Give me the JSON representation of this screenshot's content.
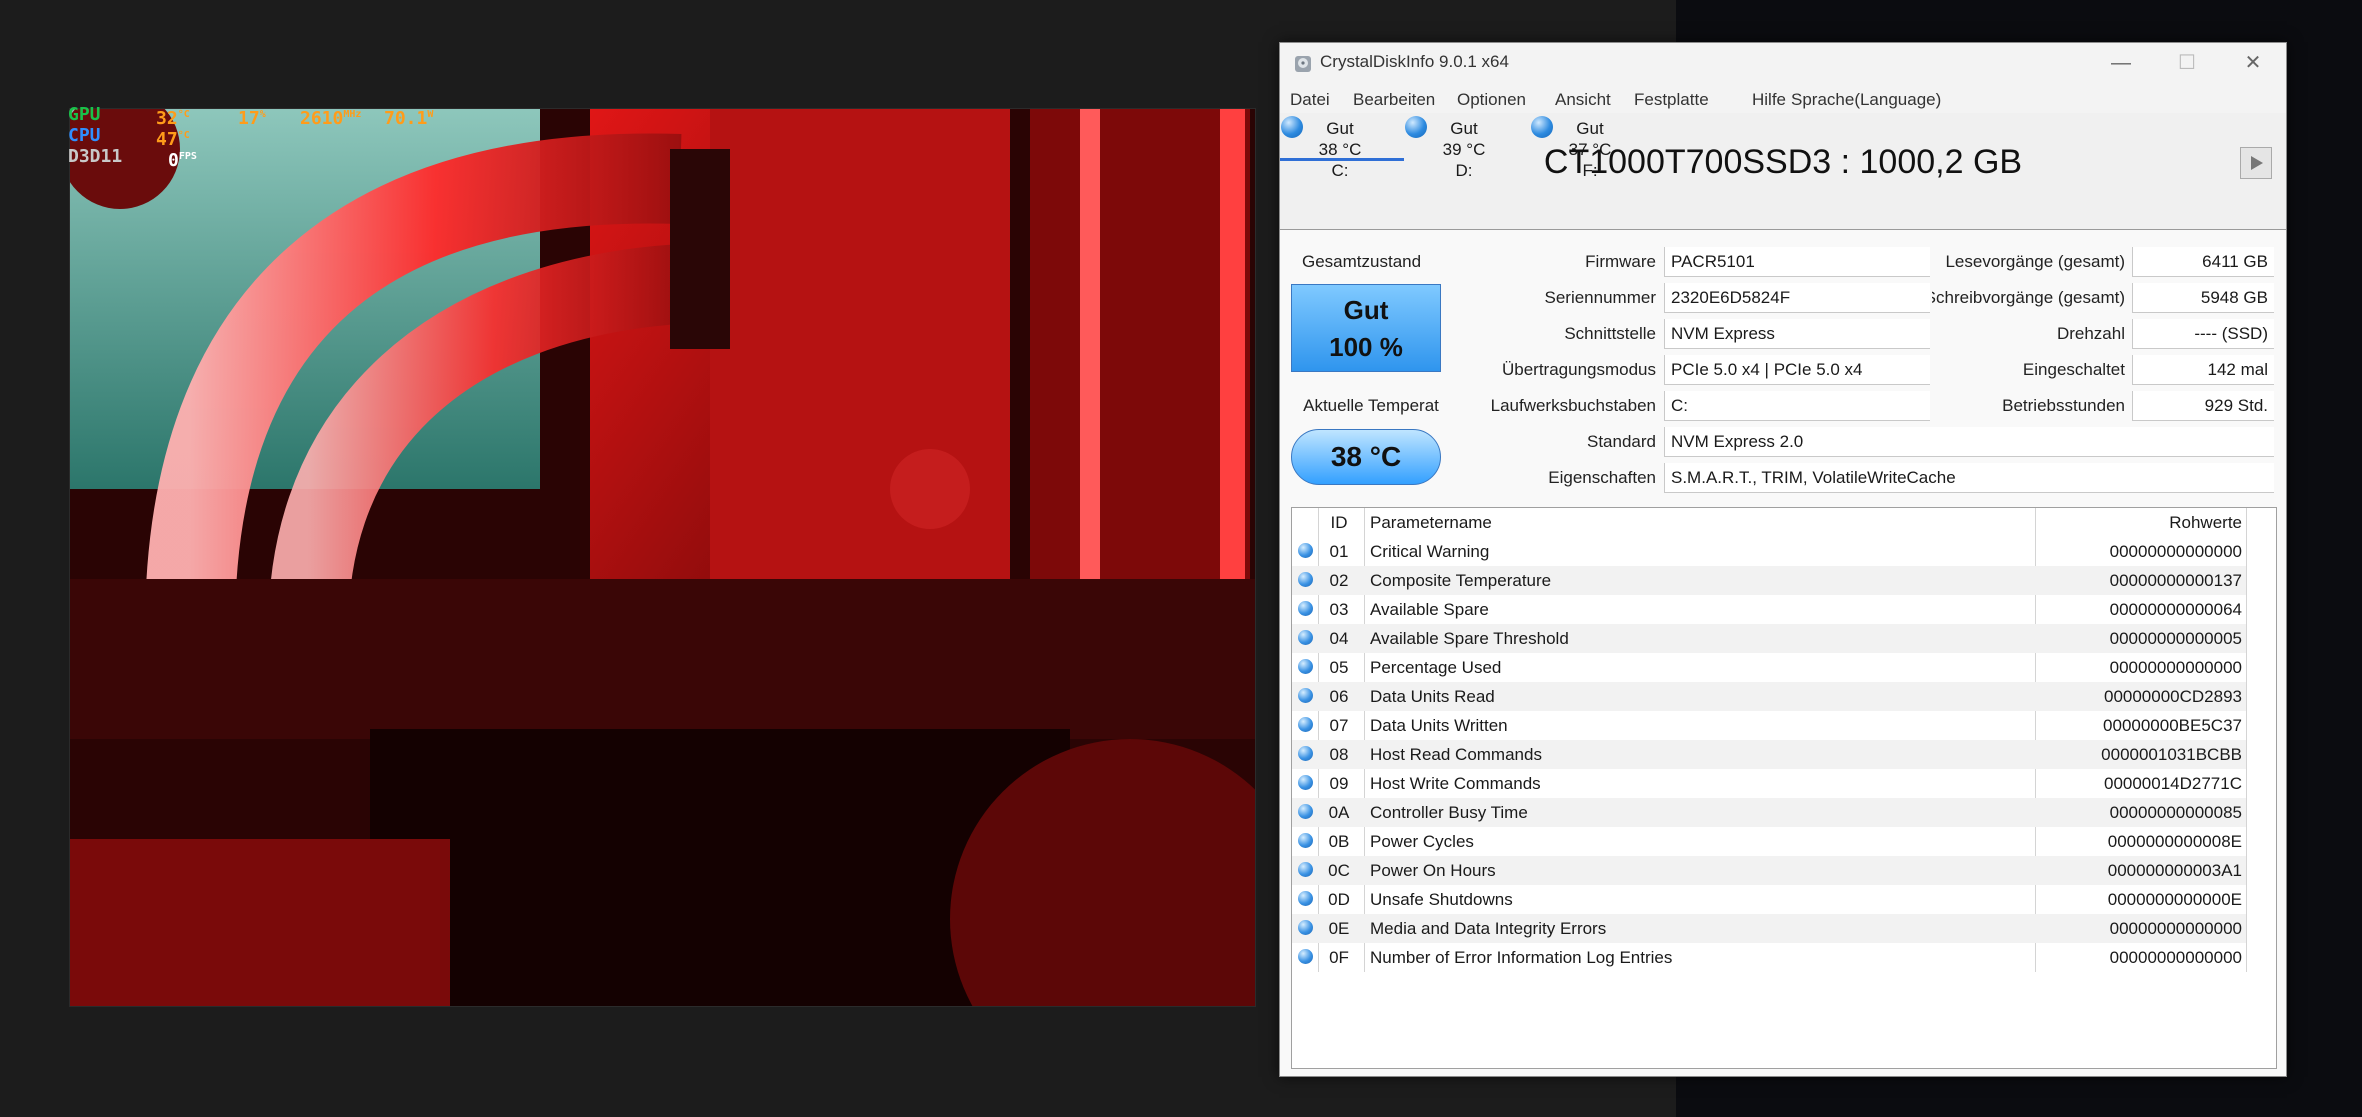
{
  "overlay": {
    "rows": [
      {
        "label": "GPU",
        "v1": "32",
        "u1": "°C",
        "v2": "17",
        "u2": "%",
        "v3": "2610",
        "u3": "MHz",
        "v4": "70.1",
        "u4": "W"
      },
      {
        "label": "CPU",
        "v1": "47",
        "u1": "°C"
      },
      {
        "label": "D3D11",
        "v1": "0",
        "u1": "FPS"
      }
    ],
    "colors": {
      "gpu": "#19c24a",
      "cpu": "#2f8fff",
      "d3d": "#c9c9c9",
      "value": "#ff9c1a"
    }
  },
  "window": {
    "title": "CrystalDiskInfo 9.0.1 x64",
    "controls": {
      "minimize": "—",
      "maximize": "☐",
      "close": "✕"
    },
    "menu": [
      "Datei",
      "Bearbeiten",
      "Optionen",
      "Ansicht",
      "Festplatte",
      "Hilfe",
      "Sprache(Language)"
    ],
    "drives": [
      {
        "status": "Gut",
        "temp": "38 °C",
        "letter": "C:"
      },
      {
        "status": "Gut",
        "temp": "39 °C",
        "letter": "D:"
      },
      {
        "status": "Gut",
        "temp": "37 °C",
        "letter": "F:"
      }
    ],
    "model": "CT1000T700SSD3 : 1000,2 GB",
    "health_label": "Gesamtzustand",
    "health_status": "Gut",
    "health_percent": "100 %",
    "temp_label": "Aktuelle Temperatur",
    "temp_value": "38 °C",
    "info": {
      "firmware_label": "Firmware",
      "firmware": "PACR5101",
      "serial_label": "Seriennummer",
      "serial": "2320E6D5824F",
      "interface_label": "Schnittstelle",
      "interface": "NVM Express",
      "transfer_label": "Übertragungsmodus",
      "transfer": "PCIe 5.0 x4 | PCIe 5.0 x4",
      "letters_label": "Laufwerksbuchstaben",
      "letters": "C:",
      "standard_label": "Standard",
      "standard": "NVM Express 2.0",
      "features_label": "Eigenschaften",
      "features": "S.M.A.R.T., TRIM, VolatileWriteCache",
      "reads_label": "Lesevorgänge (gesamt)",
      "reads": "6411 GB",
      "writes_label": "Schreibvorgänge (gesamt)",
      "writes": "5948 GB",
      "rotation_label": "Drehzahl",
      "rotation": "---- (SSD)",
      "power_count_label": "Eingeschaltet",
      "power_count": "142 mal",
      "hours_label": "Betriebsstunden",
      "hours": "929 Std."
    },
    "smart": {
      "headers": {
        "id": "ID",
        "name": "Parametername",
        "raw": "Rohwerte"
      },
      "rows": [
        {
          "id": "01",
          "name": "Critical Warning",
          "raw": "00000000000000"
        },
        {
          "id": "02",
          "name": "Composite Temperature",
          "raw": "00000000000137"
        },
        {
          "id": "03",
          "name": "Available Spare",
          "raw": "00000000000064"
        },
        {
          "id": "04",
          "name": "Available Spare Threshold",
          "raw": "00000000000005"
        },
        {
          "id": "05",
          "name": "Percentage Used",
          "raw": "00000000000000"
        },
        {
          "id": "06",
          "name": "Data Units Read",
          "raw": "00000000CD2893"
        },
        {
          "id": "07",
          "name": "Data Units Written",
          "raw": "00000000BE5C37"
        },
        {
          "id": "08",
          "name": "Host Read Commands",
          "raw": "0000001031BCBB"
        },
        {
          "id": "09",
          "name": "Host Write Commands",
          "raw": "00000014D2771C"
        },
        {
          "id": "0A",
          "name": "Controller Busy Time",
          "raw": "00000000000085"
        },
        {
          "id": "0B",
          "name": "Power Cycles",
          "raw": "0000000000008E"
        },
        {
          "id": "0C",
          "name": "Power On Hours",
          "raw": "000000000003A1"
        },
        {
          "id": "0D",
          "name": "Unsafe Shutdowns",
          "raw": "0000000000000E"
        },
        {
          "id": "0E",
          "name": "Media and Data Integrity Errors",
          "raw": "00000000000000"
        },
        {
          "id": "0F",
          "name": "Number of Error Information Log Entries",
          "raw": "00000000000000"
        }
      ]
    }
  }
}
